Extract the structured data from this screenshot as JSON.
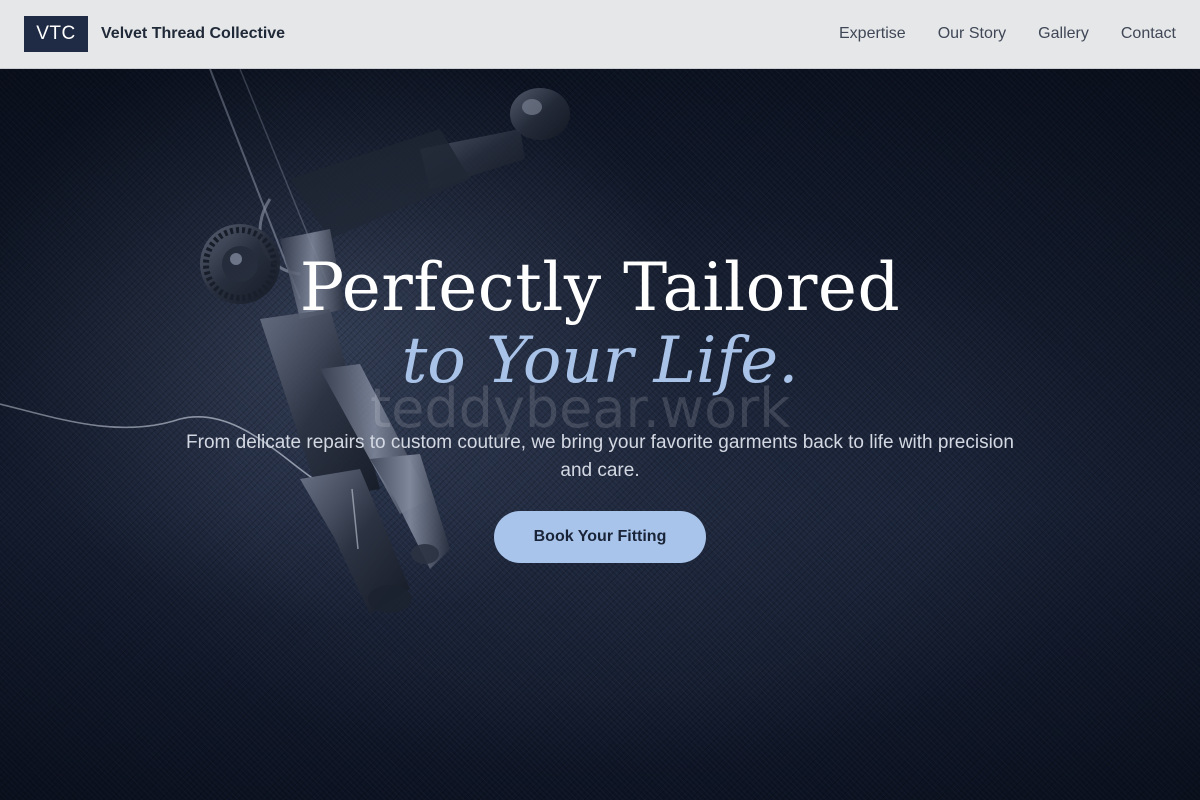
{
  "header": {
    "logo_mark": "VTC",
    "brand_name": "Velvet Thread Collective",
    "nav": [
      {
        "label": "Expertise"
      },
      {
        "label": "Our Story"
      },
      {
        "label": "Gallery"
      },
      {
        "label": "Contact"
      }
    ]
  },
  "hero": {
    "headline_line1": "Perfectly Tailored",
    "headline_line2": "to Your Life.",
    "subtitle": "From delicate repairs to custom couture, we bring your favorite garments back to life with precision and care.",
    "cta_label": "Book Your Fitting",
    "watermark": "teddybear.work"
  },
  "colors": {
    "header_bg": "#e6e7e9",
    "logo_bg": "#1f2a44",
    "accent": "#a8c4ea",
    "hero_bg": "#141c2e"
  }
}
